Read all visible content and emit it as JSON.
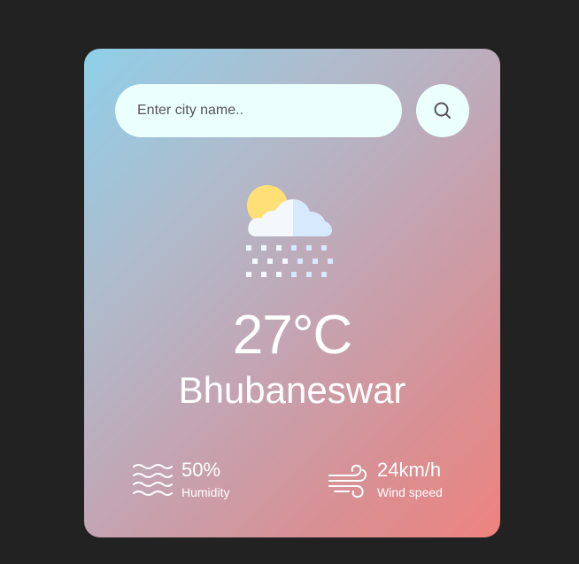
{
  "search": {
    "placeholder": "Enter city name..",
    "value": ""
  },
  "icons": {
    "search_button": "search-icon",
    "weather": "snow-cloud-sun-icon",
    "humidity": "humidity-icon",
    "wind": "wind-icon"
  },
  "weather": {
    "temperature": "27°C",
    "city": "Bhubaneswar",
    "humidity": {
      "value": "50%",
      "label": "Humidity"
    },
    "wind": {
      "value": "24km/h",
      "label": "Wind speed"
    }
  },
  "colors": {
    "page_background": "#222222",
    "card_gradient_start": "#8fcfe9",
    "card_gradient_end": "#ee8380",
    "input_background": "#ebfffc",
    "text": "#ffffff"
  }
}
